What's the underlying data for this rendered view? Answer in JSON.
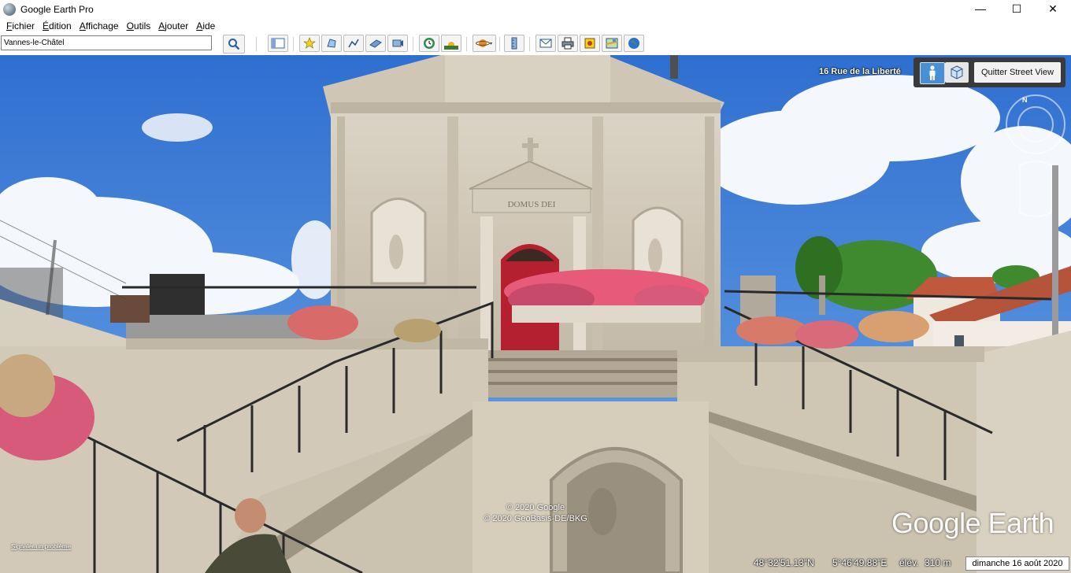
{
  "window": {
    "title": "Google Earth Pro"
  },
  "controls": {
    "minimize": "—",
    "maximize": "☐",
    "close": "✕"
  },
  "menu": [
    {
      "underline": "F",
      "rest": "ichier"
    },
    {
      "underline": "É",
      "rest": "dition"
    },
    {
      "underline": "A",
      "rest": "ffichage"
    },
    {
      "underline": "O",
      "rest": "utils"
    },
    {
      "underline": "A",
      "rest": "jouter"
    },
    {
      "underline": "A",
      "rest": "ide"
    }
  ],
  "search": {
    "value": "Vannes-le-Châtel"
  },
  "streetview": {
    "address": "16 Rue de la Liberté",
    "quit_label": "Quitter Street View",
    "compass_north": "N"
  },
  "scene": {
    "inscription": "DOMUS DEI",
    "copyright_1": "© 2020 Google",
    "copyright_2": "© 2020 GeoBasis-DE/BKG",
    "report_link": "Signaler un problème",
    "logo": "Google Earth"
  },
  "status": {
    "latitude": "48°32'51.13\"N",
    "longitude": "5°46'49.88\"E",
    "elevation_label": "élév.",
    "elevation": "310 m",
    "date": "dimanche 16 août 2020"
  },
  "colors": {
    "sky": "#3d7fd8",
    "facade": "#d6cdbd",
    "door": "#b42030",
    "flowers": "#e85a7a",
    "foliage": "#3f8a2e"
  }
}
